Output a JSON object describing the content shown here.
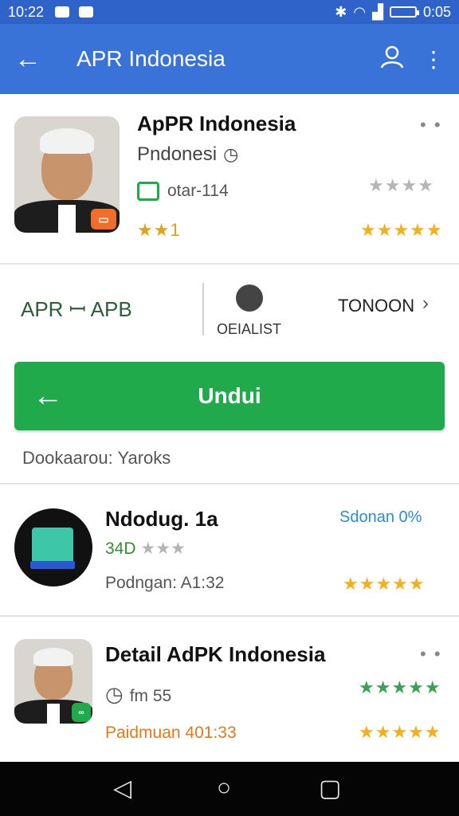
{
  "status_bar": {
    "time": "10:22",
    "battery_text": "0:05"
  },
  "app_bar": {
    "back_icon": "arrow-left-icon",
    "title": "APR Indonesia",
    "account_icon": "person-icon",
    "more_icon": "more-vert-icon"
  },
  "header_app": {
    "title": "ApPR Indonesia",
    "subtitle": "Pndonesi",
    "meta": "otar-114",
    "rating_label": "★★1",
    "stars_top": "★★★★",
    "stars_bottom": "★★★★★"
  },
  "install_row": {
    "left": "APR ꟷ APB",
    "middle": "OEIALIST",
    "right": "TONOON"
  },
  "download": {
    "label": "Undui",
    "note": "Dookaarou: Yaroks"
  },
  "list": [
    {
      "title": "Ndodug. 1a",
      "tag": "Sdonan 0%",
      "rating": "34D",
      "stars_small": "★★★",
      "time": "Podngan: A1:32",
      "stars": "★★★★★"
    },
    {
      "title": "Detail AdPK Indonesia",
      "time_icon": "clock-icon",
      "meta": "fm 55",
      "time": "Paidmuan 401:33",
      "stars_top": "★★★★★",
      "stars": "★★★★★"
    }
  ],
  "colors": {
    "primary": "#3a73d8",
    "status": "#2f63c9",
    "green": "#20aa4c",
    "star": "#f2b01e",
    "star_green": "#3aa157",
    "orange": "#e07a1a"
  }
}
